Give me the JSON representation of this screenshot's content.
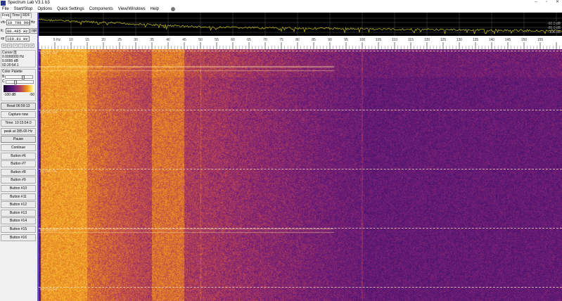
{
  "window": {
    "title": "Spectrum Lab V3.1 b3",
    "minimize": "–",
    "maximize": "▫",
    "close": "✕"
  },
  "menu": [
    "File",
    "Start/Stop",
    "Options",
    "Quick Settings",
    "Components",
    "View/Windows",
    "Help"
  ],
  "left": {
    "tabs": [
      "Freq",
      "Time",
      "RDF"
    ],
    "vfo": {
      "label": "vfo",
      "value": "10 700 000",
      "unit": "Hz"
    },
    "fc": {
      "label": "fc",
      "value": "80.485 Hz",
      "button": "opt"
    },
    "sp": {
      "label": "sp",
      "value": "160.81 Hz"
    },
    "nav_buttons": [
      "«",
      "<",
      "‹",
      "-",
      ">",
      "»"
    ],
    "cursor": {
      "title": "Cursor [f]",
      "freq": "0.0000000 Hz",
      "level": "0.0000 dB",
      "time": "02:20:54.1"
    },
    "palette": {
      "title": "Color Palette",
      "b": "B",
      "c": "C",
      "min": "-100 dB",
      "max": "-50",
      "brightness": 0.6,
      "contrast": 0.3
    },
    "buttons": [
      "Read 06:59:13",
      "Capture now",
      "Time: 10:15:54.0",
      "peak at 285.65 Hz",
      "Pause",
      "Continue",
      "Button #6",
      "Button #7",
      "Button #8",
      "Button #9",
      "Button #10",
      "Button #11",
      "Button #12",
      "Button #13",
      "Button #14",
      "Button #15",
      "Button #16"
    ]
  },
  "spectrum": {
    "db_labels": [
      "-60.0 dB",
      "-80.0 dB",
      "-100 dB"
    ],
    "line_color": "#c8c020"
  },
  "ruler": {
    "unit_label": "5 Hz",
    "ticks": [
      10,
      15,
      20,
      25,
      30,
      35,
      40,
      45,
      50,
      55,
      60,
      65,
      70,
      75,
      80,
      85,
      90,
      95,
      100,
      105,
      110,
      115,
      120,
      125,
      130,
      135,
      140,
      145,
      150,
      155
    ],
    "hz_min": 0,
    "hz_max": 162
  },
  "waterfall": {
    "timestamps": [
      "02:10:00",
      "02:05:01",
      "02:00:01",
      "01:55:00",
      "01:50:00"
    ]
  }
}
